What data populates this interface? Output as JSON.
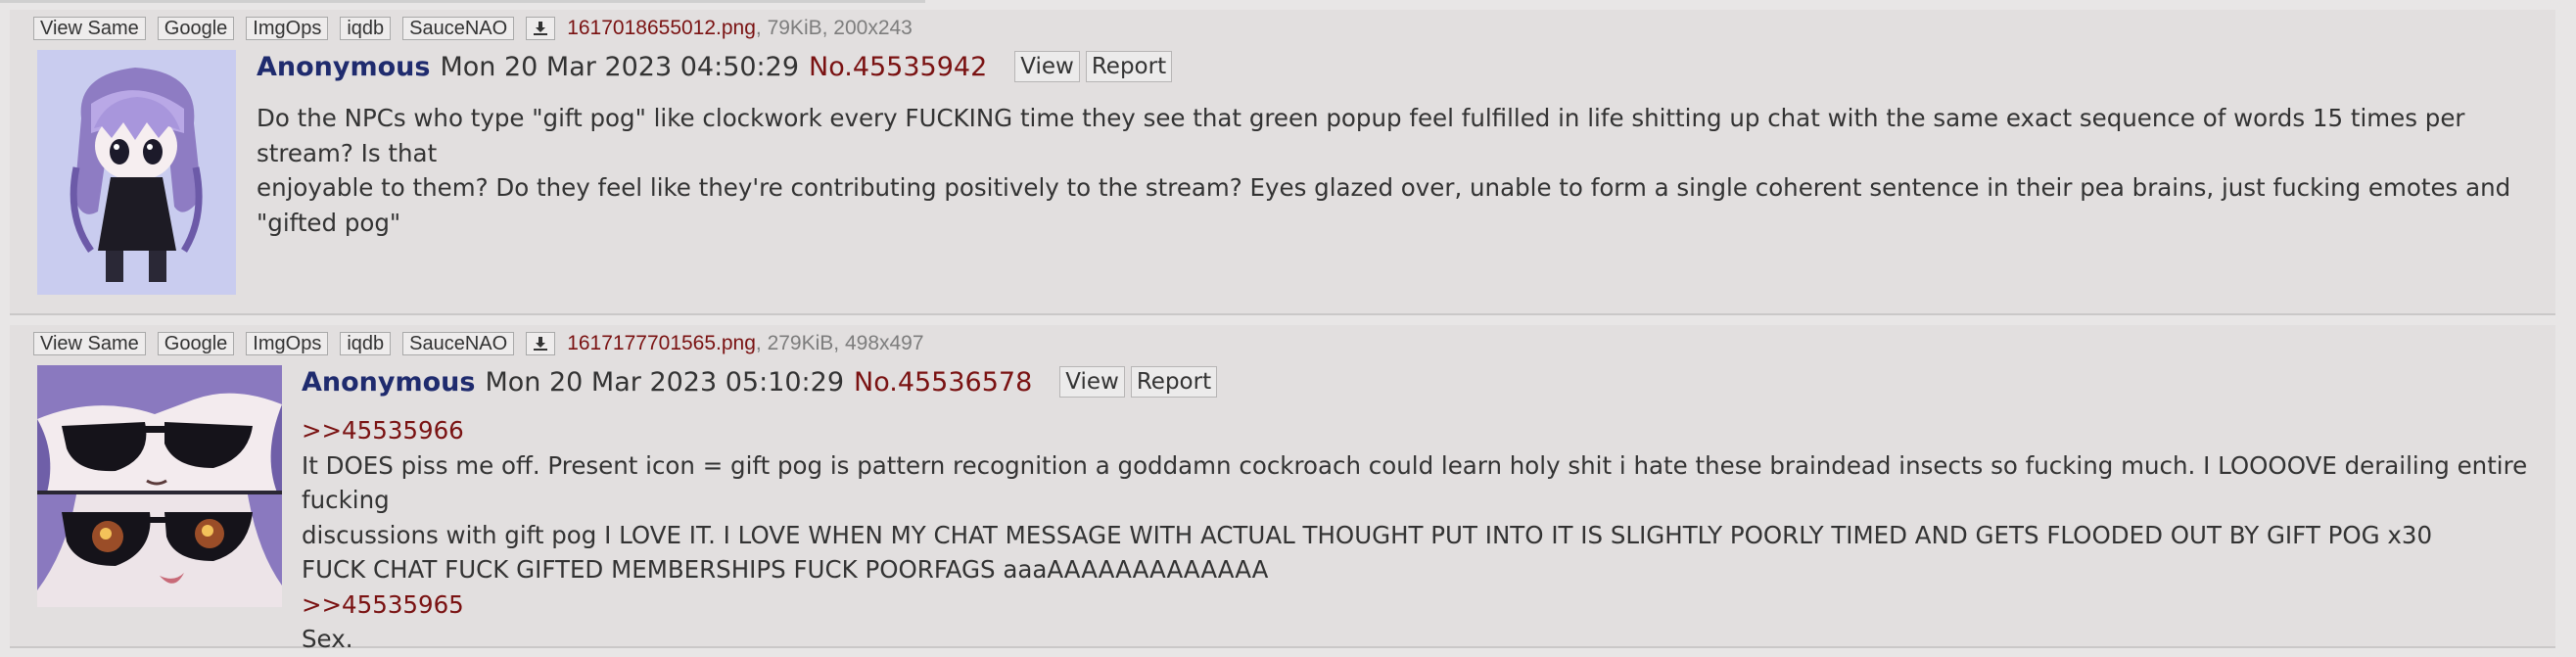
{
  "file_buttons": {
    "view_same": "View Same",
    "google": "Google",
    "imgops": "ImgOps",
    "iqdb": "iqdb",
    "saucenao": "SauceNAO"
  },
  "posts": [
    {
      "file_name": "1617018655012.png",
      "file_meta": ", 79KiB, 200x243",
      "name": "Anonymous",
      "date": "Mon 20 Mar 2023 04:50:29",
      "post_no": "No.45535942",
      "view_label": "View",
      "report_label": "Report",
      "body_lines": [
        "Do the NPCs who type \"gift pog\" like clockwork every FUCKING time they see that green popup feel fulfilled in life shitting up chat with the same exact sequence of words 15 times per stream? Is that",
        "enjoyable to them? Do they feel like they're contributing positively to the stream? Eyes glazed over, unable to form a single coherent sentence in their pea brains, just fucking emotes and \"gifted pog\""
      ]
    },
    {
      "file_name": "1617177701565.png",
      "file_meta": ", 279KiB, 498x497",
      "name": "Anonymous",
      "date": "Mon 20 Mar 2023 05:10:29",
      "post_no": "No.45536578",
      "view_label": "View",
      "report_label": "Report",
      "quote1": ">>45535966",
      "body_lines": [
        "It DOES piss me off. Present icon = gift pog is pattern recognition a goddamn cockroach could learn holy shit i hate these braindead insects so fucking much. I LOOOOVE derailing entire fucking",
        "discussions with gift pog I LOVE IT. I LOVE WHEN MY CHAT MESSAGE WITH ACTUAL THOUGHT PUT INTO IT IS SLIGHTLY POORLY TIMED AND GETS FLOODED OUT BY GIFT POG x30",
        "FUCK CHAT FUCK GIFTED MEMBERSHIPS FUCK POORFAGS aaaAAAAAAAAAAAAA"
      ],
      "quote2": ">>45535965",
      "last_line": "Sex."
    }
  ],
  "colors": {
    "page_bg": "#e8e6e6",
    "post_bg": "#e2dfdf",
    "name": "#1f2b6e",
    "post_no": "#7a1212",
    "quote_link": "#7a1212",
    "file_meta": "#7d7d7d"
  },
  "icons": {
    "download": "download-icon",
    "thumb1": "anime-girl-thumbnail",
    "thumb2": "anime-girl-sunglasses-thumbnail"
  }
}
